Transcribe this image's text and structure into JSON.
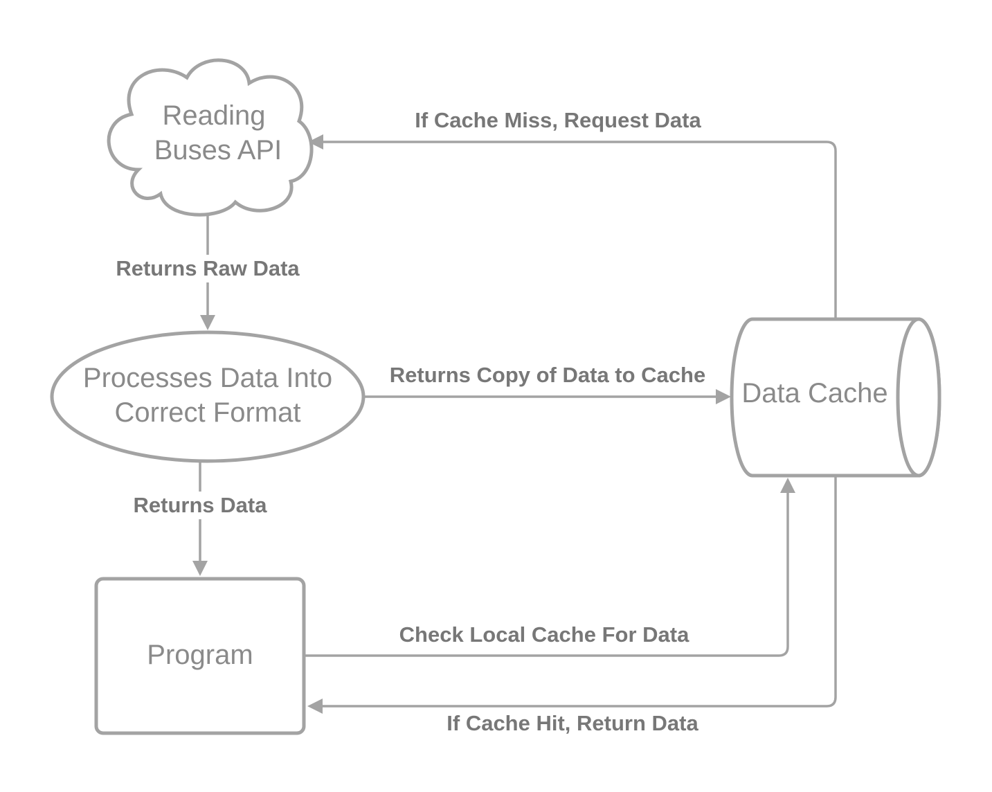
{
  "nodes": {
    "api": {
      "line1": "Reading",
      "line2": "Buses API"
    },
    "process": {
      "line1": "Processes Data Into",
      "line2": "Correct Format"
    },
    "program": {
      "label": "Program"
    },
    "cache": {
      "label": "Data Cache"
    }
  },
  "edges": {
    "raw_data": "Returns Raw Data",
    "returns_data": "Returns Data",
    "copy_to_cache": "Returns Copy of Data to Cache",
    "cache_miss": "If Cache Miss, Request Data",
    "check_cache": "Check Local Cache For Data",
    "cache_hit": "If Cache Hit, Return Data"
  },
  "colors": {
    "stroke": "#a3a3a3",
    "text": "#8a8a8a",
    "edge_text": "#777777"
  }
}
